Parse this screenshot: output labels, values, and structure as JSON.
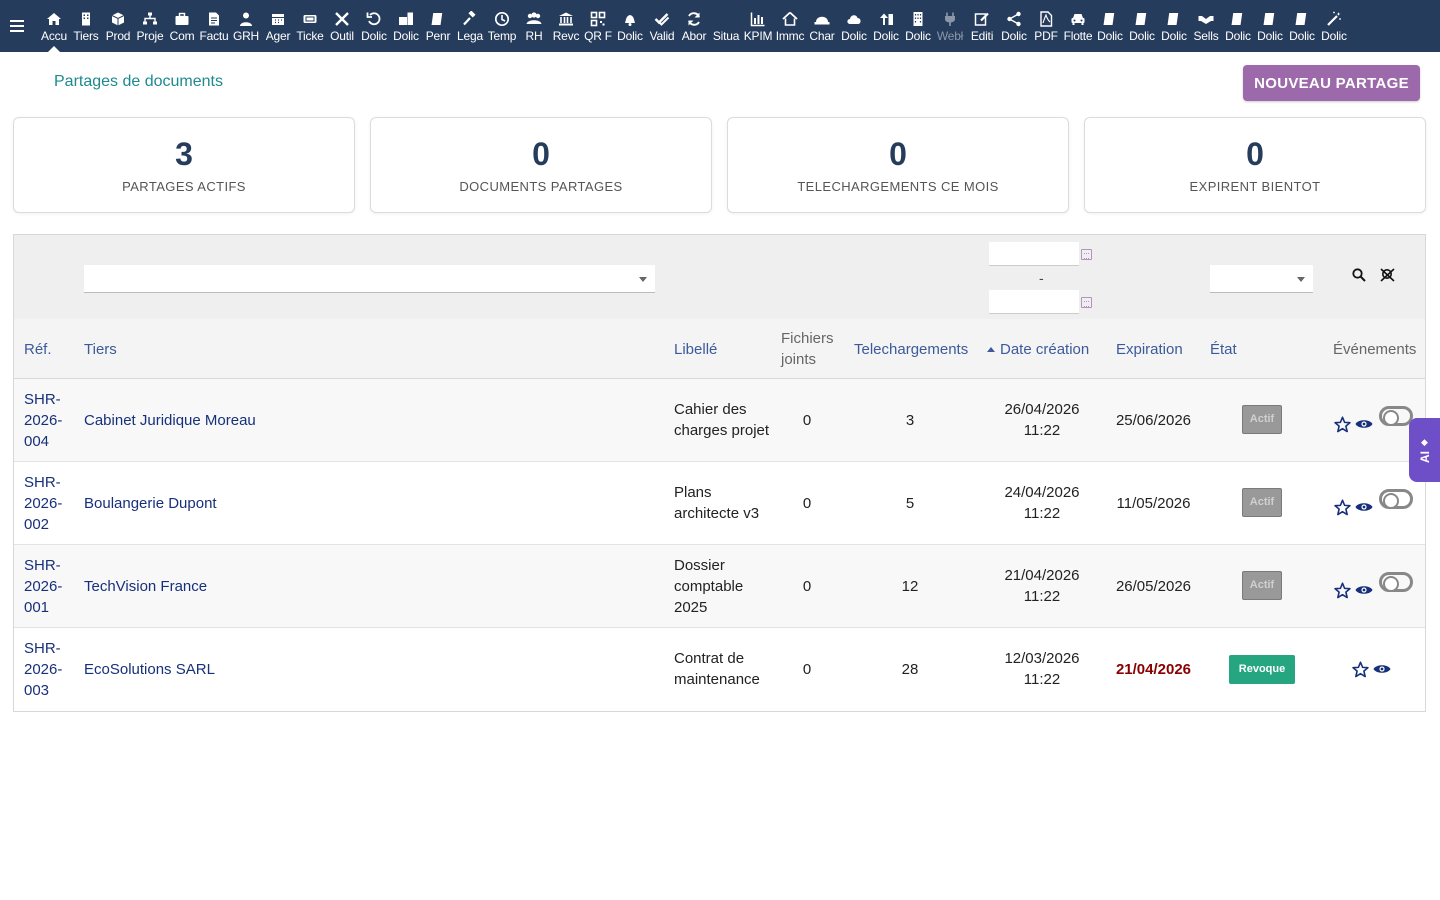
{
  "menu": {
    "hamburger_icon": "menu-icon",
    "items": [
      {
        "label": "Accu",
        "icon": "home-icon",
        "active": true
      },
      {
        "label": "Tiers",
        "icon": "building-icon"
      },
      {
        "label": "Prod",
        "icon": "cube-icon"
      },
      {
        "label": "Proje",
        "icon": "sitemap-icon"
      },
      {
        "label": "Com",
        "icon": "briefcase-icon"
      },
      {
        "label": "Factu",
        "icon": "invoice-icon"
      },
      {
        "label": "GRH",
        "icon": "user-tie-icon"
      },
      {
        "label": "Ager",
        "icon": "calendar-icon"
      },
      {
        "label": "Ticke",
        "icon": "ticket-icon"
      },
      {
        "label": "Outil",
        "icon": "tools-icon"
      },
      {
        "label": "Dolic",
        "icon": "undo-icon"
      },
      {
        "label": "Dolic",
        "icon": "suitcase-doc-icon"
      },
      {
        "label": "Penr",
        "icon": "doc-icon"
      },
      {
        "label": "Lega",
        "icon": "gavel-icon"
      },
      {
        "label": "Temp",
        "icon": "clock-icon"
      },
      {
        "label": "RH",
        "icon": "users-icon"
      },
      {
        "label": "Revc",
        "icon": "bank-icon"
      },
      {
        "label": "QR F",
        "icon": "qrcode-icon"
      },
      {
        "label": "Dolic",
        "icon": "bell-icon"
      },
      {
        "label": "Valid",
        "icon": "check-double-icon"
      },
      {
        "label": "Abor",
        "icon": "sync-icon"
      },
      {
        "label": "Situa",
        "icon": "blank-icon"
      },
      {
        "label": "KPIM",
        "icon": "chart-bar-icon"
      },
      {
        "label": "Immc",
        "icon": "house-icon"
      },
      {
        "label": "Char",
        "icon": "hard-hat-icon"
      },
      {
        "label": "Dolic",
        "icon": "cloud-icon"
      },
      {
        "label": "Dolic",
        "icon": "upload-icon"
      },
      {
        "label": "Dolic",
        "icon": "office-building-icon"
      },
      {
        "label": "Webł",
        "icon": "plug-icon",
        "dim": true
      },
      {
        "label": "Editi",
        "icon": "edit-icon"
      },
      {
        "label": "Dolic",
        "icon": "share-icon"
      },
      {
        "label": "PDF",
        "icon": "pdf-icon"
      },
      {
        "label": "Flotte",
        "icon": "car-icon"
      },
      {
        "label": "Dolic",
        "icon": "doc-icon"
      },
      {
        "label": "Dolic",
        "icon": "doc-icon"
      },
      {
        "label": "Dolic",
        "icon": "doc-icon"
      },
      {
        "label": "Sells",
        "icon": "handshake-icon"
      },
      {
        "label": "Dolic",
        "icon": "doc-icon"
      },
      {
        "label": "Dolic",
        "icon": "doc-icon"
      },
      {
        "label": "Dolic",
        "icon": "doc-icon"
      },
      {
        "label": "Dolic",
        "icon": "magic-wand-icon"
      }
    ]
  },
  "page": {
    "title": "Partages de documents",
    "new_button": "NOUVEAU PARTAGE"
  },
  "stats": [
    {
      "value": "3",
      "label": "PARTAGES ACTIFS"
    },
    {
      "value": "0",
      "label": "DOCUMENTS PARTAGES"
    },
    {
      "value": "0",
      "label": "TELECHARGEMENTS CE MOIS"
    },
    {
      "value": "0",
      "label": "EXPIRENT BIENTOT"
    }
  ],
  "filters": {
    "date_separator": "-",
    "search_icon": "search-icon",
    "clear_icon": "clear-filter-icon"
  },
  "columns": {
    "ref": "Réf.",
    "tiers": "Tiers",
    "libelle": "Libellé",
    "fichiers": "Fichiers joints",
    "telechargements": "Telechargements",
    "date_creation": "Date création",
    "expiration": "Expiration",
    "etat": "État",
    "evenements": "Événements"
  },
  "rows": [
    {
      "ref": "SHR-2026-004",
      "tiers": "Cabinet Juridique Moreau",
      "libelle": "Cahier des charges projet",
      "fichiers": "0",
      "telechargements": "3",
      "date_creation": "26/04/2026 11:22",
      "expiration": "25/06/2026",
      "etat": "Actif",
      "etat_type": "actif",
      "has_toggle": true
    },
    {
      "ref": "SHR-2026-002",
      "tiers": "Boulangerie Dupont",
      "libelle": "Plans architecte v3",
      "fichiers": "0",
      "telechargements": "5",
      "date_creation": "24/04/2026 11:22",
      "expiration": "11/05/2026",
      "etat": "Actif",
      "etat_type": "actif",
      "has_toggle": true
    },
    {
      "ref": "SHR-2026-001",
      "tiers": "TechVision France",
      "libelle": "Dossier comptable 2025",
      "fichiers": "0",
      "telechargements": "12",
      "date_creation": "21/04/2026 11:22",
      "expiration": "26/05/2026",
      "etat": "Actif",
      "etat_type": "actif",
      "has_toggle": true
    },
    {
      "ref": "SHR-2026-003",
      "tiers": "EcoSolutions SARL",
      "libelle": "Contrat de maintenance",
      "fichiers": "0",
      "telechargements": "28",
      "date_creation": "12/03/2026 11:22",
      "expiration": "21/04/2026",
      "etat": "Revoque",
      "etat_type": "revoque",
      "expired": true,
      "has_toggle": false
    }
  ],
  "ai_tab": {
    "label": "AI"
  },
  "colors": {
    "topbar": "#263c5c",
    "accent": "#9c6aaa",
    "title": "#1e8a8e",
    "link": "#17307a",
    "revoque": "#25a580",
    "ai": "#6f4fc7"
  }
}
